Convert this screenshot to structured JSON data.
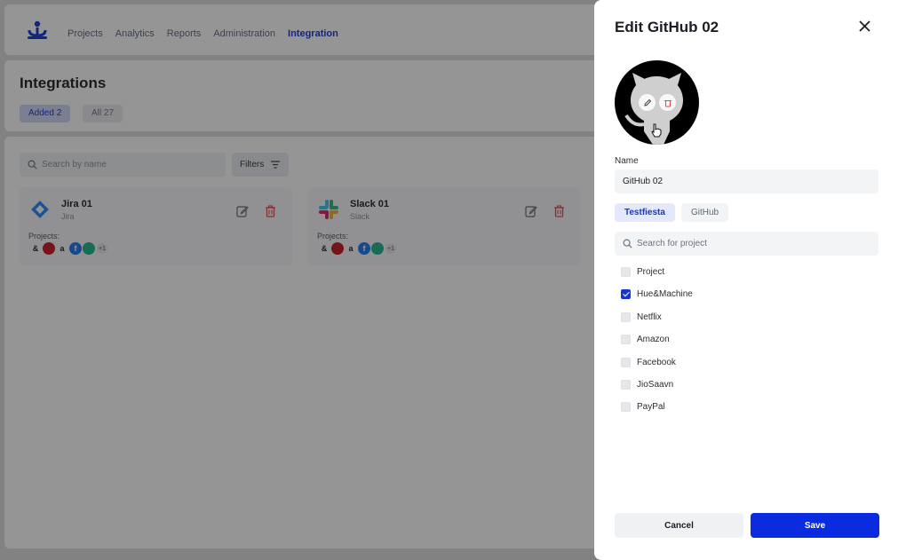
{
  "nav": {
    "items": [
      {
        "label": "Projects",
        "active": false
      },
      {
        "label": "Analytics",
        "active": false
      },
      {
        "label": "Reports",
        "active": false
      },
      {
        "label": "Administration",
        "active": false
      },
      {
        "label": "Integration",
        "active": true
      }
    ]
  },
  "page": {
    "title": "Integrations",
    "chips": {
      "added_label": "Added",
      "added_count": "2",
      "all_label": "All",
      "all_count": "27"
    },
    "search_placeholder": "Search by name",
    "filters_label": "Filters"
  },
  "cards": [
    {
      "name": "Jira 01",
      "type": "Jira",
      "projects_label": "Projects:",
      "more": "+1",
      "logo": "jira-logo"
    },
    {
      "name": "Slack 01",
      "type": "Slack",
      "projects_label": "Projects:",
      "more": "+1",
      "logo": "slack-logo"
    }
  ],
  "project_avatars": [
    {
      "glyph": "&",
      "color": "#222222"
    },
    {
      "glyph": "",
      "color": "#c4161c"
    },
    {
      "glyph": "a",
      "color": "#222222"
    },
    {
      "glyph": "f",
      "color": "#1877f2"
    },
    {
      "glyph": "",
      "color": "#1db38a"
    }
  ],
  "drawer": {
    "title": "Edit GitHub 02",
    "name_label": "Name",
    "name_value": "GitHub 02",
    "tabs": [
      "Testfiesta",
      "GitHub"
    ],
    "search_placeholder": "Search for project",
    "projects": [
      {
        "name": "Project",
        "checked": false
      },
      {
        "name": "Hue&Machine",
        "checked": true
      },
      {
        "name": "Netflix",
        "checked": false
      },
      {
        "name": "Amazon",
        "checked": false
      },
      {
        "name": "Facebook",
        "checked": false
      },
      {
        "name": "JioSaavn",
        "checked": false
      },
      {
        "name": "PayPal",
        "checked": false
      }
    ],
    "cancel_label": "Cancel",
    "save_label": "Save"
  },
  "colors": {
    "accent": "#1436cf",
    "primary_button": "#0a2be0",
    "delete": "#e5484d"
  }
}
